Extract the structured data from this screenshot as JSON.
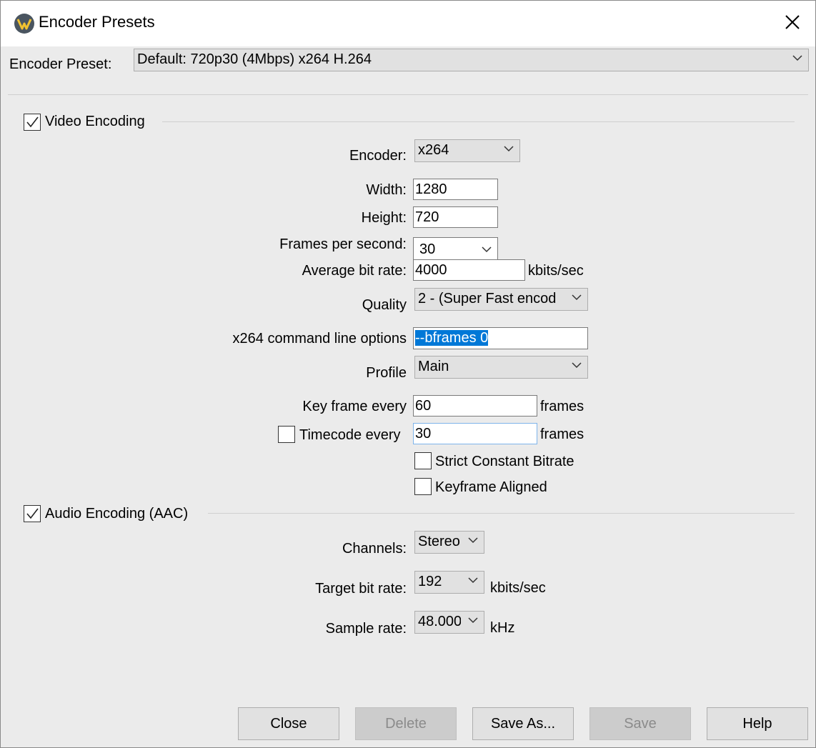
{
  "window": {
    "title": "Encoder Presets"
  },
  "preset": {
    "label": "Encoder Preset:",
    "value": "Default: 720p30 (4Mbps) x264 H.264"
  },
  "video": {
    "section_label": "Video Encoding",
    "enabled": true,
    "encoder": {
      "label": "Encoder:",
      "value": "x264"
    },
    "width": {
      "label": "Width:",
      "value": "1280"
    },
    "height": {
      "label": "Height:",
      "value": "720"
    },
    "fps": {
      "label": "Frames per second:",
      "value": "30"
    },
    "bitrate": {
      "label": "Average bit rate:",
      "value": "4000",
      "unit": "kbits/sec"
    },
    "quality": {
      "label": "Quality",
      "value": "2 - (Super Fast encod"
    },
    "cmdline": {
      "label": "x264 command line options",
      "value": "--bframes 0"
    },
    "profile": {
      "label": "Profile",
      "value": "Main"
    },
    "keyframe": {
      "label": "Key frame every",
      "value": "60",
      "unit": "frames"
    },
    "timecode": {
      "label": "Timecode every",
      "value": "30",
      "unit": "frames",
      "enabled": false
    },
    "strict_cbr": {
      "label": "Strict Constant Bitrate",
      "checked": false
    },
    "keyframe_aligned": {
      "label": "Keyframe Aligned",
      "checked": false
    }
  },
  "audio": {
    "section_label": "Audio Encoding (AAC)",
    "enabled": true,
    "channels": {
      "label": "Channels:",
      "value": "Stereo"
    },
    "target_bitrate": {
      "label": "Target bit rate:",
      "value": "192",
      "unit": "kbits/sec"
    },
    "sample_rate": {
      "label": "Sample rate:",
      "value": "48.000",
      "unit": "kHz"
    }
  },
  "buttons": {
    "close": "Close",
    "delete": "Delete",
    "save_as": "Save As...",
    "save": "Save",
    "help": "Help"
  },
  "colors": {
    "window_bg": "#ebebeb",
    "titlebar_bg": "#ffffff",
    "selection": "#0078d7",
    "button_face": "#e1e1e1",
    "disabled_button": "#cccccc",
    "focus_border": "#7eb4ea"
  },
  "icons": {
    "app": "wirecast-logo-icon",
    "close": "close-x-icon",
    "dropdown": "chevron-down-icon",
    "check": "checkmark-icon"
  }
}
